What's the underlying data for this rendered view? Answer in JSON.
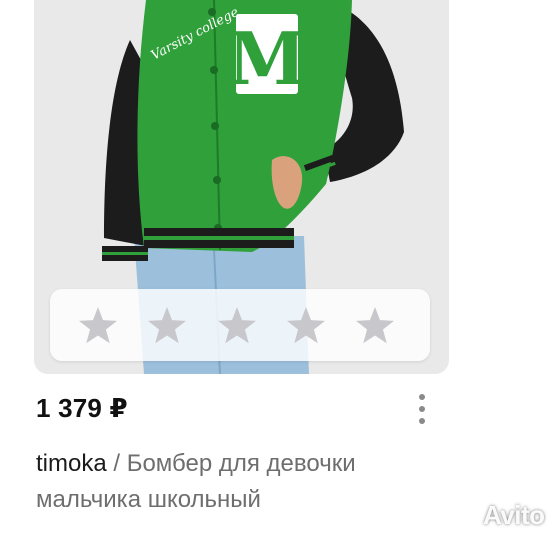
{
  "listing": {
    "price": "1 379 ₽",
    "brand": "timoka",
    "separator": " / ",
    "title_line1": "Бомбер для девочки",
    "title_line2": "мальчика школьный",
    "jacket_letter": "M",
    "patch_script": "Varsity college"
  },
  "rating": {
    "stars_total": 5,
    "stars_filled": 0,
    "star_color": "#c7c7cc"
  },
  "watermark": {
    "text": "Avito"
  },
  "colors": {
    "jacket_green": "#2fa03a",
    "sleeve_black": "#1c1c1c",
    "jeans_blue": "#9cc0dc",
    "background": "#e9e9ea"
  }
}
